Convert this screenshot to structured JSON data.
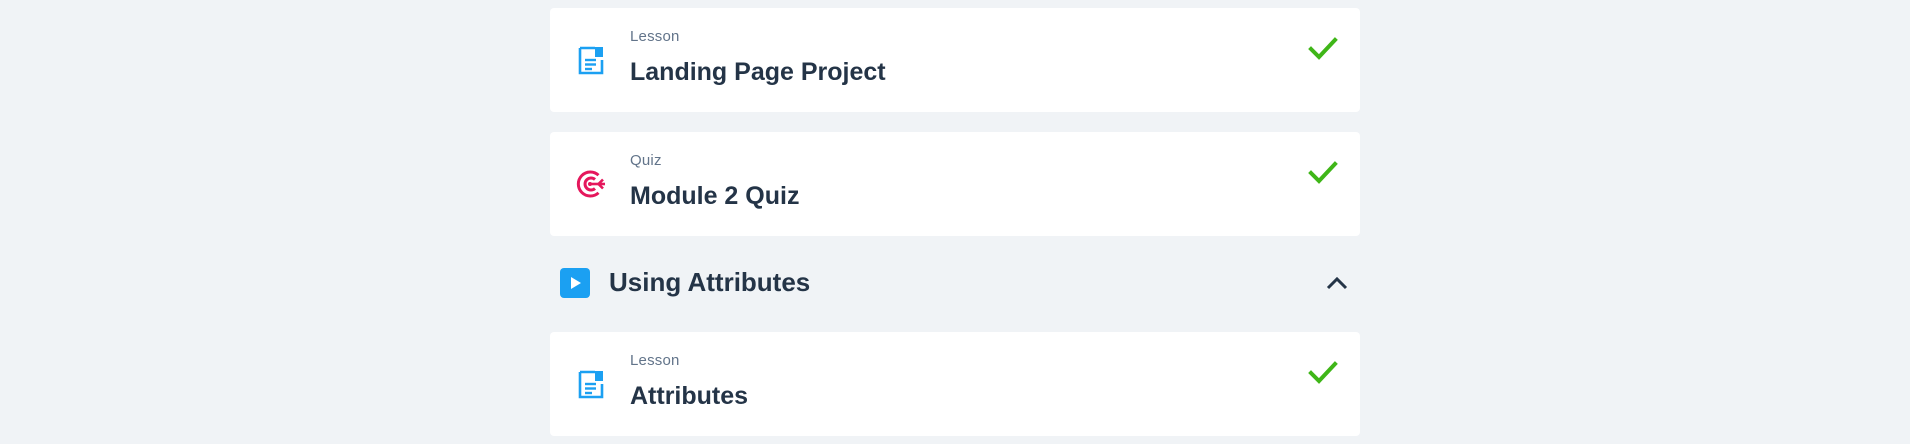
{
  "items": [
    {
      "kind": "Lesson",
      "title": "Landing Page Project",
      "icon": "document-icon",
      "completed": true
    },
    {
      "kind": "Quiz",
      "title": "Module 2 Quiz",
      "icon": "target-icon",
      "completed": true
    }
  ],
  "section": {
    "title": "Using Attributes",
    "icon": "play-icon",
    "expanded": true
  },
  "section_items": [
    {
      "kind": "Lesson",
      "title": "Attributes",
      "icon": "document-icon",
      "completed": true
    }
  ],
  "colors": {
    "background": "#f0f3f6",
    "lesson_icon": "#1ba0f2",
    "quiz_icon": "#e5175c",
    "check": "#3fb618",
    "title_text": "#243447",
    "kind_text": "#62748a"
  }
}
